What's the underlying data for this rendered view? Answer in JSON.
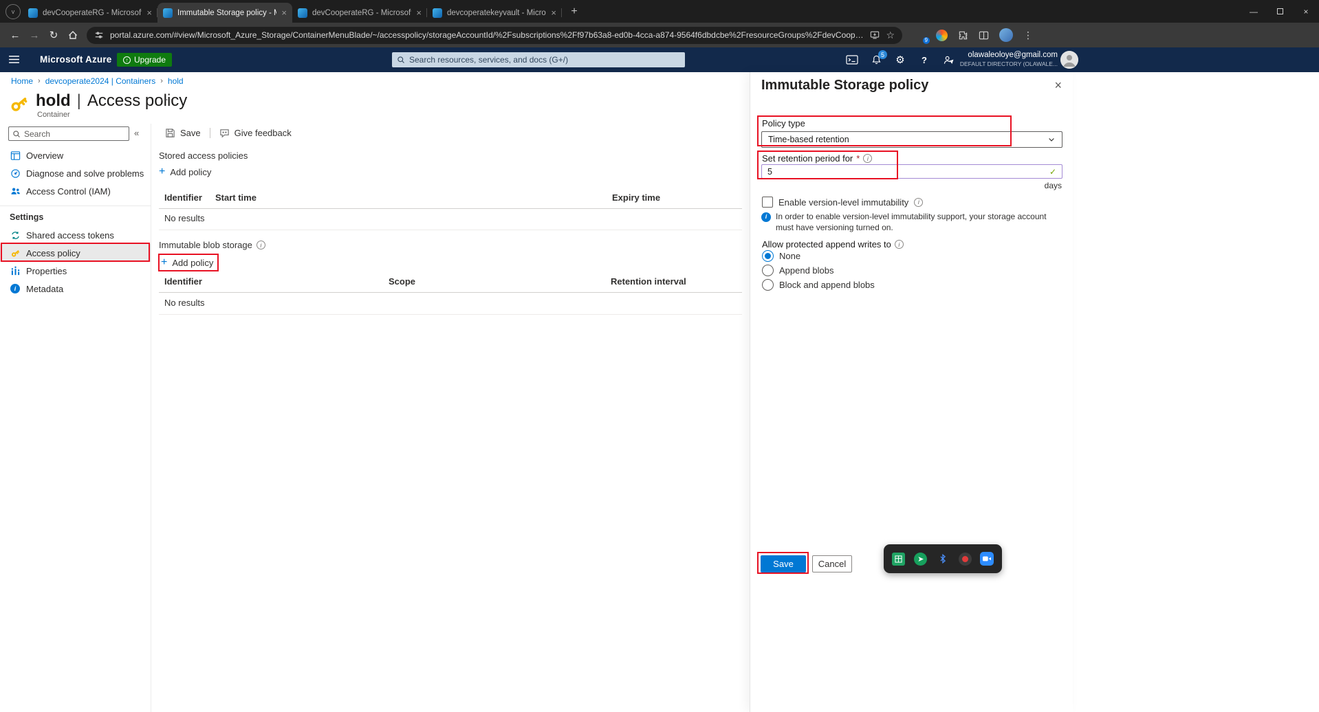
{
  "browser": {
    "tabs": [
      {
        "title": "devCooperateRG - Microsoft A..."
      },
      {
        "title": "Immutable Storage policy - Mic..."
      },
      {
        "title": "devCooperateRG - Microsoft A..."
      },
      {
        "title": "devcoperatekeyvault - Microso..."
      }
    ],
    "url": "portal.azure.com/#view/Microsoft_Azure_Storage/ContainerMenuBlade/~/accesspolicy/storageAccountId/%2Fsubscriptions%2Ff97b63a8-ed0b-4cca-a874-9564f6dbdcbe%2FresourceGroups%2FdevCooperateRG%2Fproviders%...",
    "extension_badge": "9"
  },
  "azure_header": {
    "brand": "Microsoft Azure",
    "upgrade_label": "Upgrade",
    "search_placeholder": "Search resources, services, and docs (G+/)",
    "notification_badge": "5",
    "account_email": "olawaleoloye@gmail.com",
    "account_directory": "DEFAULT DIRECTORY (OLAWALE..."
  },
  "breadcrumb": {
    "home": "Home",
    "containers": "devcoperate2024 | Containers",
    "current": "hold"
  },
  "page": {
    "resource": "hold",
    "separator": "|",
    "blade": "Access policy",
    "resource_type": "Container"
  },
  "sidebar": {
    "search_placeholder": "Search",
    "items": [
      {
        "label": "Overview"
      },
      {
        "label": "Diagnose and solve problems"
      },
      {
        "label": "Access Control (IAM)"
      }
    ],
    "settings_header": "Settings",
    "settings_items": [
      {
        "label": "Shared access tokens"
      },
      {
        "label": "Access policy"
      },
      {
        "label": "Properties"
      },
      {
        "label": "Metadata"
      }
    ]
  },
  "toolbar": {
    "save_label": "Save",
    "feedback_label": "Give feedback"
  },
  "stored_policies": {
    "title": "Stored access policies",
    "add_label": "Add policy",
    "columns": [
      "Identifier",
      "Start time",
      "Expiry time"
    ],
    "empty": "No results"
  },
  "immutable_storage": {
    "title": "Immutable blob storage",
    "add_label": "Add policy",
    "columns": [
      "Identifier",
      "Scope",
      "Retention interval"
    ],
    "empty": "No results"
  },
  "panel": {
    "title": "Immutable Storage policy",
    "policy_type_label": "Policy type",
    "policy_type_value": "Time-based retention",
    "retention_label": "Set retention period for",
    "required_marker": "*",
    "retention_value": "5",
    "retention_unit": "days",
    "version_checkbox_label": "Enable version-level immutability",
    "info_text": "In order to enable version-level immutability support, your storage account must have versioning turned on.",
    "append_writes_label": "Allow protected append writes to",
    "radios": [
      {
        "label": "None",
        "checked": true
      },
      {
        "label": "Append blobs",
        "checked": false
      },
      {
        "label": "Block and append blobs",
        "checked": false
      }
    ],
    "save_label": "Save",
    "cancel_label": "Cancel"
  },
  "colors": {
    "accent": "#0078d4",
    "annotation_red": "#e81123",
    "header_navy": "#12294b",
    "upgrade_green": "#0f7b0f",
    "key_yellow": "#f5b800"
  }
}
